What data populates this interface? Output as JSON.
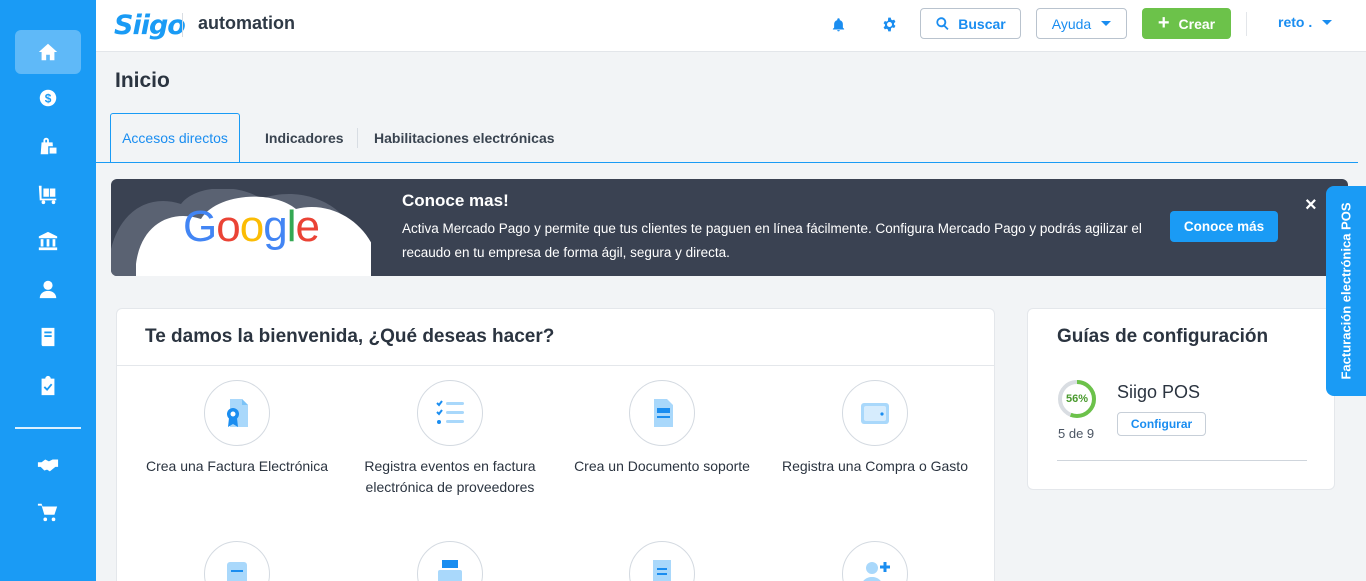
{
  "header": {
    "logo": "Siigo",
    "company": "automation",
    "search_label": "Buscar",
    "help_label": "Ayuda",
    "create_label": "Crear",
    "user_label": "reto ."
  },
  "page": {
    "title": "Inicio",
    "tabs": [
      {
        "label": "Accesos directos"
      },
      {
        "label": "Indicadores"
      },
      {
        "label": "Habilitaciones electrónicas"
      }
    ]
  },
  "banner": {
    "title": "Conoce mas!",
    "text": "Activa Mercado Pago y permite que tus clientes te paguen en línea fácilmente. Configura Mercado Pago y podrás agilizar el recaudo en tu empresa de forma ágil, segura y directa.",
    "button_label": "Conoce más",
    "close": "×",
    "logo": "Google"
  },
  "welcome": {
    "title": "Te damos la bienvenida, ¿Qué deseas hacer?",
    "actions": [
      {
        "label": "Crea una Factura Electrónica",
        "icon": "invoice-icon"
      },
      {
        "label": "Registra eventos en factura electrónica de proveedores",
        "icon": "events-list-icon"
      },
      {
        "label": "Crea un Documento soporte",
        "icon": "support-document-icon"
      },
      {
        "label": "Registra una Compra o Gasto",
        "icon": "wallet-icon"
      },
      {
        "label": "",
        "icon": "note-icon"
      },
      {
        "label": "",
        "icon": "cash-register-icon"
      },
      {
        "label": "",
        "icon": "receipt-icon"
      },
      {
        "label": "",
        "icon": "add-user-icon"
      }
    ]
  },
  "guide": {
    "title": "Guías de configuración",
    "items": [
      {
        "name": "Siigo POS",
        "percent_label": "56%",
        "progress": 0.56,
        "count": "5 de 9",
        "button_label": "Configurar"
      }
    ]
  },
  "side_tab": {
    "label": "Facturación electrónica POS"
  },
  "sidebar": {
    "items": [
      {
        "icon": "home-icon"
      },
      {
        "icon": "money-icon"
      },
      {
        "icon": "shopping-bag-icon"
      },
      {
        "icon": "cart-flatbed-icon"
      },
      {
        "icon": "bank-icon"
      },
      {
        "icon": "user-icon"
      },
      {
        "icon": "book-icon"
      },
      {
        "icon": "clipboard-check-icon"
      },
      {
        "icon": "handshake-icon"
      },
      {
        "icon": "shopping-cart-icon"
      }
    ]
  },
  "colors": {
    "primary": "#1a9bf5",
    "accent_green": "#6cc24a",
    "banner_bg": "#3a4252"
  }
}
